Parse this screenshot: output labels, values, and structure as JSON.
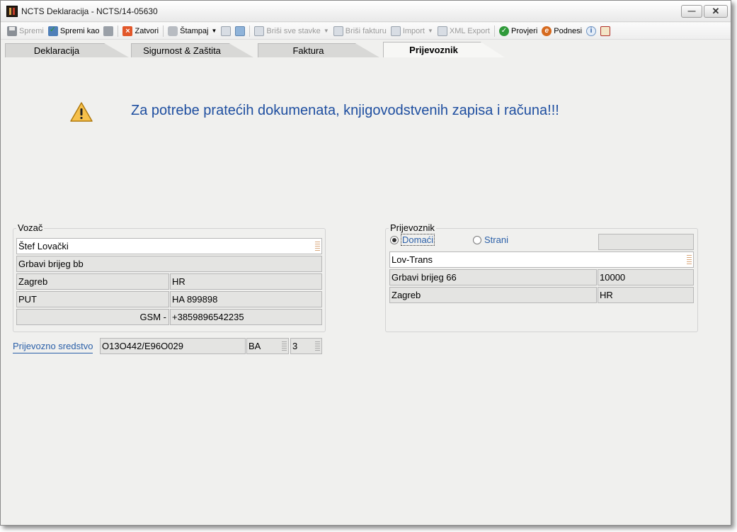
{
  "window": {
    "title": "NCTS Deklaracija - NCTS/14-05630",
    "minimize_glyph": "—",
    "close_glyph": "✕"
  },
  "toolbar": {
    "save": "Spremi",
    "save_as": "Spremi kao",
    "close": "Zatvori",
    "print": "Štampaj",
    "delete_all_items": "Briši sve stavke",
    "delete_invoice": "Briši fakturu",
    "import": "Import",
    "xml_export": "XML Export",
    "check": "Provjeri",
    "submit": "Podnesi"
  },
  "tabs": [
    {
      "label": "Deklaracija",
      "active": false
    },
    {
      "label": "Sigurnost & Zaštita",
      "active": false
    },
    {
      "label": "Faktura",
      "active": false
    },
    {
      "label": "Prijevoznik",
      "active": true
    }
  ],
  "warning": {
    "text": "Za potrebe pratećih dokumenata, knjigovodstvenih zapisa i računa!!!"
  },
  "driver": {
    "title": "Vozač",
    "name": "Štef Lovački",
    "address": "Grbavi brijeg bb",
    "city": "Zagreb",
    "country": "HR",
    "doc_type": "PUT",
    "doc_number": "HA 899898",
    "phone_label": "GSM -",
    "phone": "+3859896542235"
  },
  "vehicle": {
    "label": "Prijevozno sredstvo",
    "registration": "O13O442/E96O029",
    "country": "BA",
    "type": "3"
  },
  "carrier": {
    "title": "Prijevoznik",
    "option_domestic": "Domaći",
    "option_foreign": "Strani",
    "selected": "Domaći",
    "name": "Lov-Trans",
    "address": "Grbavi brijeg 66",
    "postal_code": "10000",
    "city": "Zagreb",
    "country": "HR"
  },
  "colors": {
    "accent_text": "#1f4fa0",
    "link": "#2a5fa8",
    "panel": "#f0f0ee"
  }
}
